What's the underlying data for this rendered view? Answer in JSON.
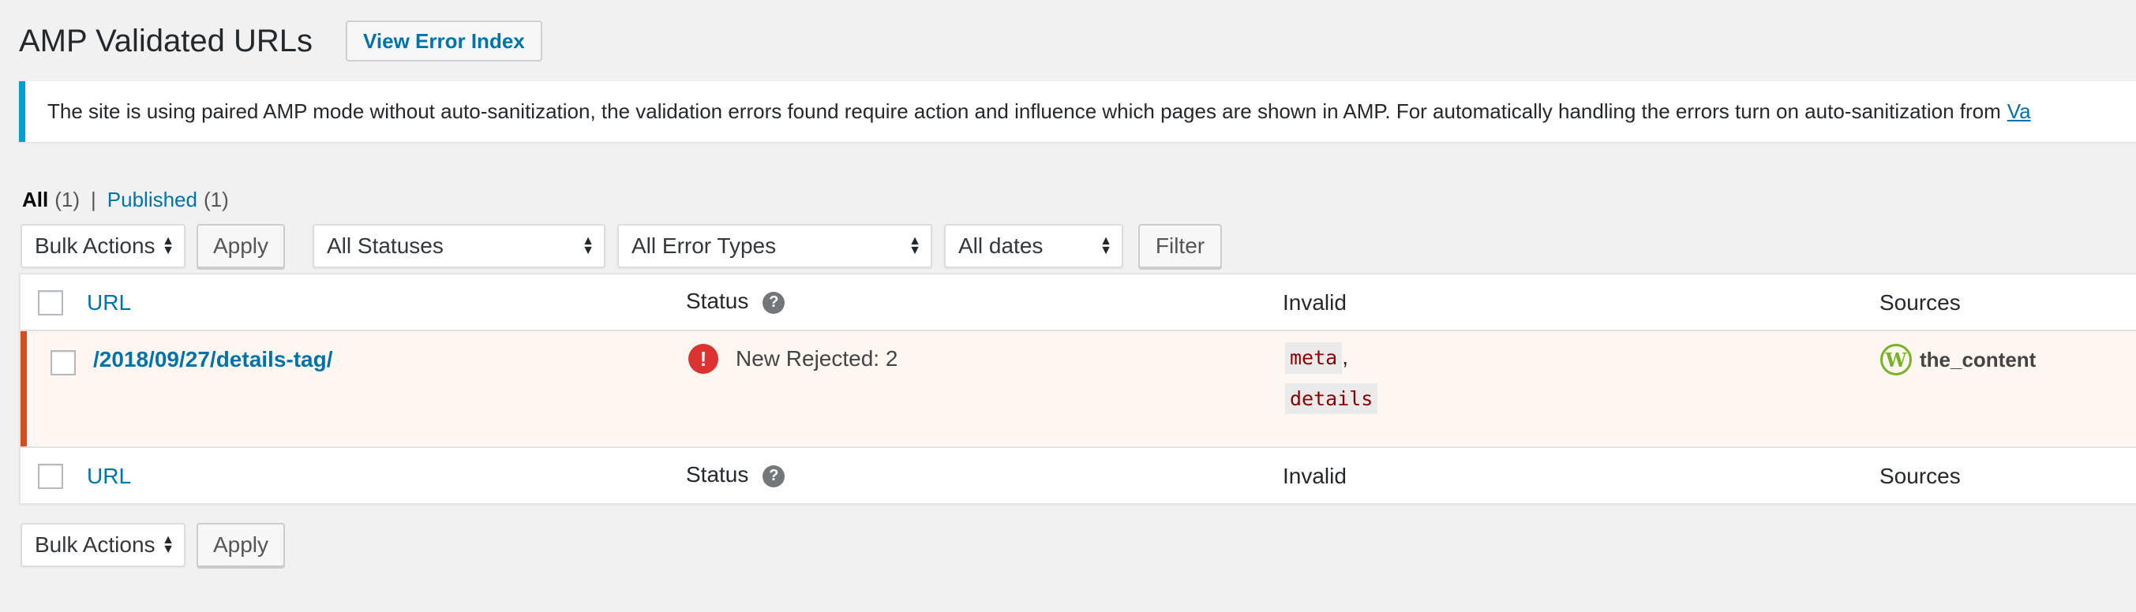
{
  "header": {
    "title": "AMP Validated URLs",
    "action_label": "View Error Index"
  },
  "notice": {
    "text": "The site is using paired AMP mode without auto-sanitization, the validation errors found require action and influence which pages are shown in AMP. For automatically handling the errors turn on auto-sanitization from",
    "link_text": "Va"
  },
  "views": {
    "all_label": "All",
    "all_count": "(1)",
    "separator": "|",
    "published_label": "Published",
    "published_count": "(1)"
  },
  "top_nav": {
    "bulk_actions": "Bulk Actions",
    "apply": "Apply",
    "status_filter": "All Statuses",
    "error_type_filter": "All Error Types",
    "date_filter": "All dates",
    "filter_button": "Filter"
  },
  "columns": {
    "url": "URL",
    "status": "Status",
    "help": "?",
    "invalid": "Invalid",
    "sources": "Sources"
  },
  "rows": [
    {
      "url": "/2018/09/27/details-tag/",
      "status_icon": "!",
      "status": "New Rejected: 2",
      "invalid_tags": [
        "meta",
        "details"
      ],
      "invalid_sep": ",",
      "source_icon": "W",
      "source": "the_content"
    }
  ],
  "bottom_nav": {
    "bulk_actions": "Bulk Actions",
    "apply": "Apply"
  },
  "colors": {
    "link": "#0073aa",
    "notice_border": "#00a0d2",
    "error_row_border": "#d54e21",
    "error_row_bg": "#fef7f1",
    "error_icon": "#dc3232",
    "wordpress_icon": "#77b227"
  }
}
